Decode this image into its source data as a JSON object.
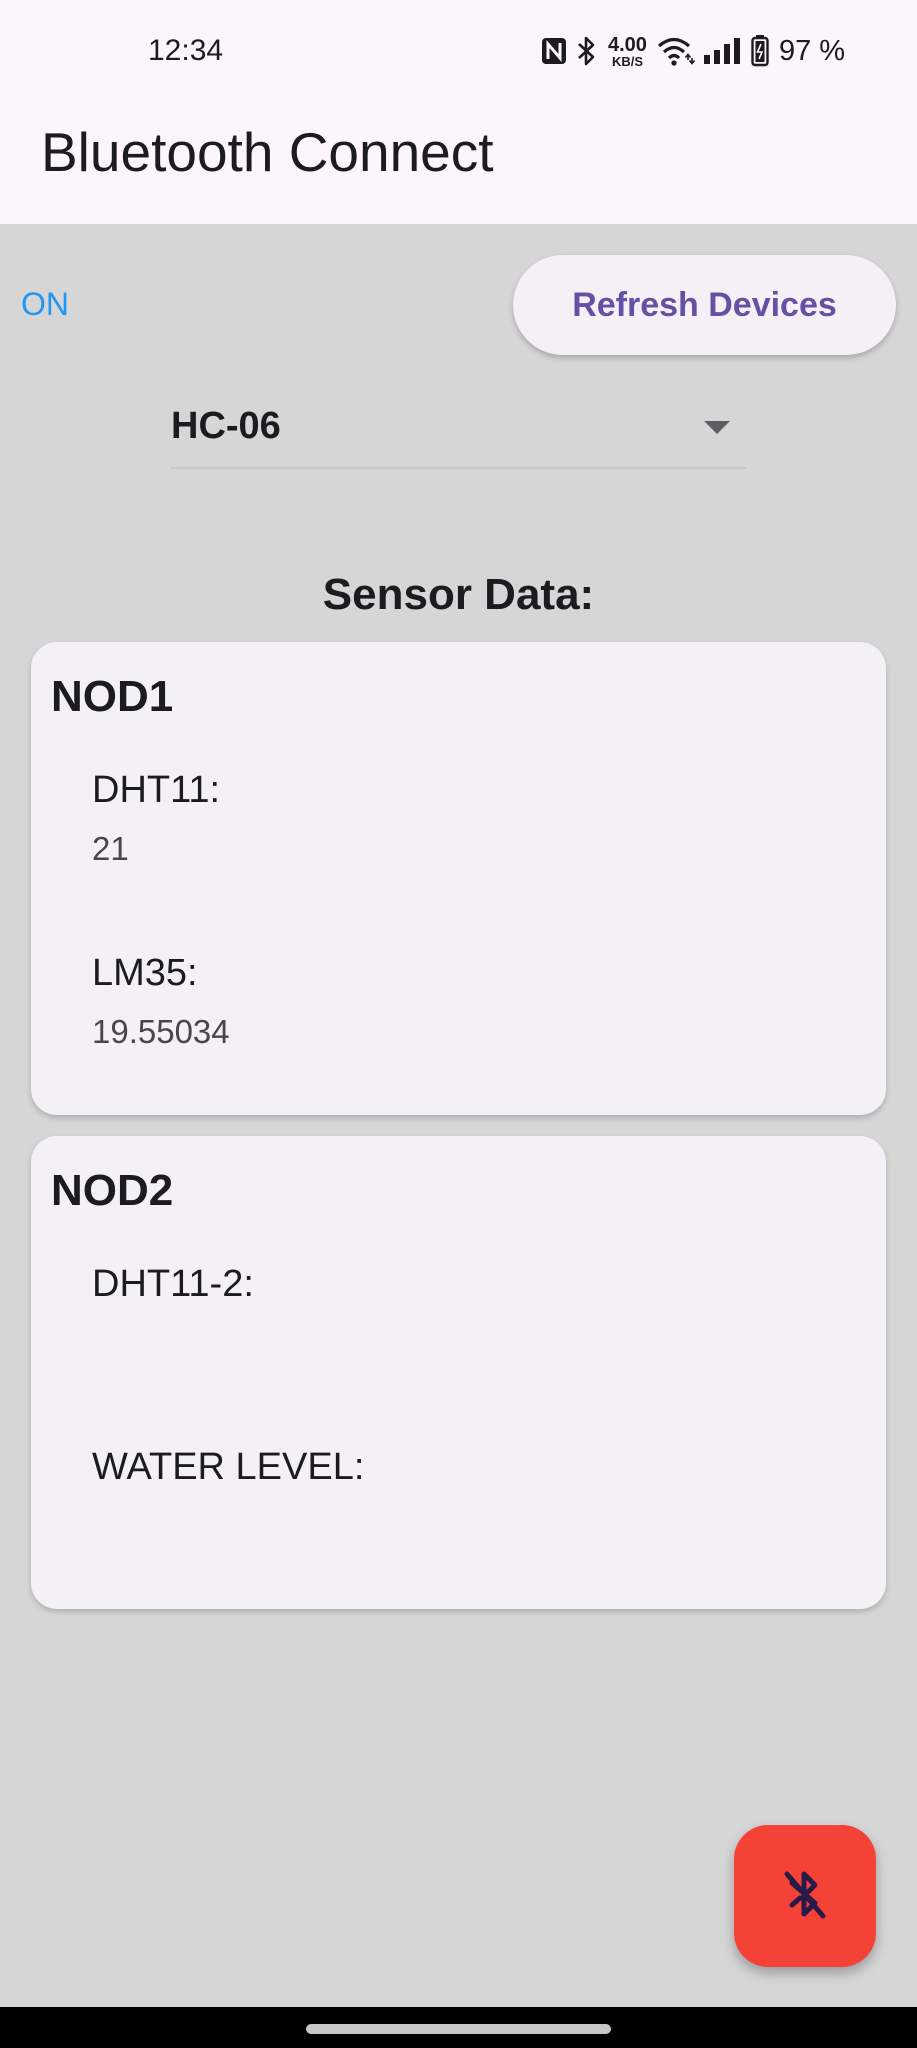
{
  "status_bar": {
    "time": "12:34",
    "net_speed_value": "4.00",
    "net_speed_unit": "KB/S",
    "battery_percent": "97 %"
  },
  "app_bar": {
    "title": "Bluetooth Connect"
  },
  "controls": {
    "bluetooth_state": "ON",
    "refresh_label": "Refresh Devices",
    "selected_device": "HC-06"
  },
  "section_title": "Sensor Data:",
  "nodes": [
    {
      "title": "NOD1",
      "sensors": [
        {
          "label": "DHT11:",
          "value": "21"
        },
        {
          "label": "LM35:",
          "value": "19.55034"
        }
      ]
    },
    {
      "title": "NOD2",
      "sensors": [
        {
          "label": "DHT11-2:",
          "value": ""
        },
        {
          "label": "WATER LEVEL:",
          "value": ""
        }
      ]
    }
  ],
  "fab": {
    "icon": "bluetooth-disabled-icon"
  },
  "colors": {
    "accent": "#6750a4",
    "bt_state": "#2196f3",
    "fab": "#f44336",
    "background": "#d6d6d6",
    "card": "#f3f0f6"
  }
}
